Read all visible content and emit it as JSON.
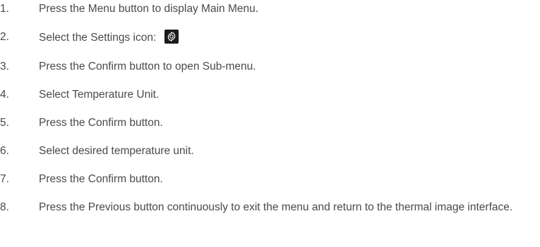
{
  "steps": [
    {
      "number": "1.",
      "text": "Press the Menu button to display Main Menu."
    },
    {
      "number": "2.",
      "text": "Select the Settings icon:",
      "icon": "settings-gear-icon"
    },
    {
      "number": "3.",
      "text": "Press the Confirm button to open Sub-menu."
    },
    {
      "number": "4.",
      "text": "Select Temperature Unit."
    },
    {
      "number": "5.",
      "text": "Press the Confirm button."
    },
    {
      "number": "6.",
      "text": "Select desired temperature unit."
    },
    {
      "number": "7.",
      "text": "Press the Confirm button."
    },
    {
      "number": "8.",
      "text": "Press the Previous button continuously to exit the menu and return to the thermal image interface."
    }
  ]
}
